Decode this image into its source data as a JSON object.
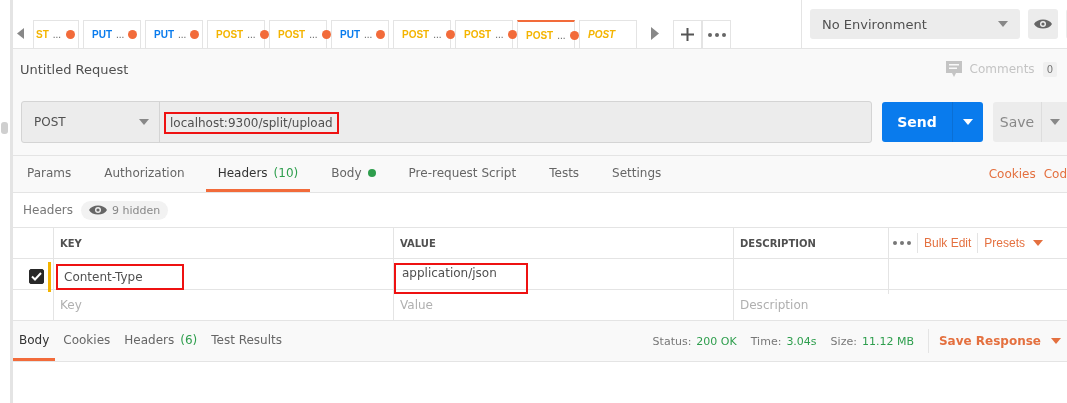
{
  "tabs": [
    {
      "method": "ST",
      "kind": "post",
      "name": "...",
      "unsaved": true,
      "selected": false,
      "preview": false
    },
    {
      "method": "PUT",
      "kind": "put",
      "name": "...",
      "unsaved": true,
      "selected": false,
      "preview": false
    },
    {
      "method": "PUT",
      "kind": "put",
      "name": "...",
      "unsaved": true,
      "selected": false,
      "preview": false
    },
    {
      "method": "POST",
      "kind": "post",
      "name": "...",
      "unsaved": true,
      "selected": false,
      "preview": false
    },
    {
      "method": "POST",
      "kind": "post",
      "name": "...",
      "unsaved": true,
      "selected": false,
      "preview": false
    },
    {
      "method": "PUT",
      "kind": "put",
      "name": "...",
      "unsaved": true,
      "selected": false,
      "preview": false
    },
    {
      "method": "POST",
      "kind": "post",
      "name": "...",
      "unsaved": true,
      "selected": false,
      "preview": false
    },
    {
      "method": "POST",
      "kind": "post",
      "name": "...",
      "unsaved": true,
      "selected": false,
      "preview": false
    },
    {
      "method": "POST",
      "kind": "post",
      "name": "...",
      "unsaved": true,
      "selected": true,
      "preview": false
    },
    {
      "method": "POST",
      "kind": "post",
      "unsaved": false,
      "selected": false,
      "preview": true
    }
  ],
  "environment": {
    "value": "No Environment"
  },
  "request": {
    "title": "Untitled Request",
    "comments_label": "Comments",
    "comments_count": "0",
    "method": "POST",
    "url": "localhost:9300/split/upload",
    "url_highlighted": true,
    "send": "Send",
    "save": "Save"
  },
  "request_tabs": [
    {
      "label": "Params",
      "selected": false
    },
    {
      "label": "Authorization",
      "selected": false
    },
    {
      "label": "Headers",
      "count": "(10)",
      "selected": true
    },
    {
      "label": "Body",
      "dot": true,
      "selected": false
    },
    {
      "label": "Pre-request Script",
      "selected": false
    },
    {
      "label": "Tests",
      "selected": false
    },
    {
      "label": "Settings",
      "selected": false
    }
  ],
  "request_links": [
    "Cookies",
    "Cod"
  ],
  "headers_bar": {
    "title": "Headers",
    "hidden": "9 hidden"
  },
  "table": {
    "columns": [
      "KEY",
      "VALUE",
      "DESCRIPTION"
    ],
    "bulk_edit": "Bulk Edit",
    "presets": "Presets",
    "rows": [
      {
        "checked": true,
        "key": "Content-Type",
        "value": "application/json",
        "key_highlighted": true,
        "value_highlighted": true
      }
    ],
    "placeholder": {
      "key": "Key",
      "value": "Value",
      "description": "Description"
    }
  },
  "response": {
    "tabs": [
      {
        "label": "Body",
        "selected": true
      },
      {
        "label": "Cookies",
        "selected": false
      },
      {
        "label": "Headers",
        "count": "(6)",
        "selected": false
      },
      {
        "label": "Test Results",
        "selected": false
      }
    ],
    "stats": [
      {
        "label": "Status:",
        "value": "200 OK"
      },
      {
        "label": "Time:",
        "value": "3.04s"
      },
      {
        "label": "Size:",
        "value": "11.12 MB"
      }
    ],
    "save": "Save Response"
  }
}
